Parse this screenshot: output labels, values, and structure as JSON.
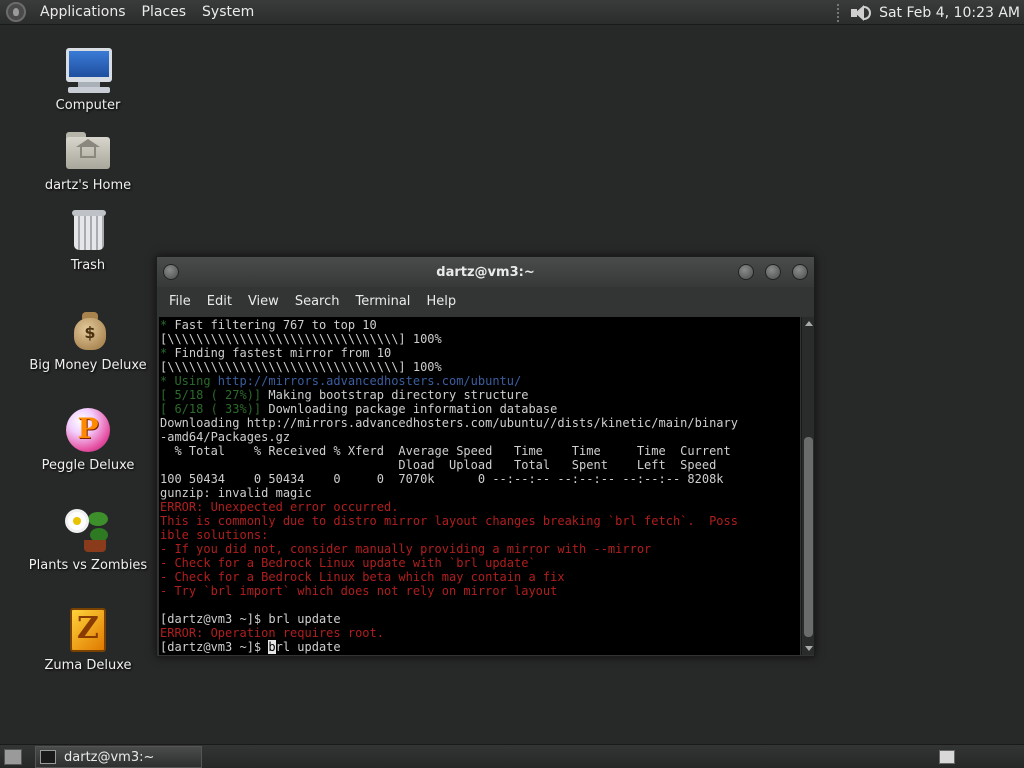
{
  "top_panel": {
    "menus": [
      "Applications",
      "Places",
      "System"
    ],
    "clock": "Sat Feb  4, 10:23 AM"
  },
  "desktop_icons": [
    {
      "name": "computer",
      "label": "Computer"
    },
    {
      "name": "home",
      "label": "dartz's Home"
    },
    {
      "name": "trash",
      "label": "Trash"
    },
    {
      "name": "money",
      "label": "Big Money Deluxe"
    },
    {
      "name": "peggle",
      "label": "Peggle Deluxe"
    },
    {
      "name": "plants",
      "label": "Plants vs Zombies"
    },
    {
      "name": "zuma",
      "label": "Zuma Deluxe"
    }
  ],
  "terminal": {
    "title": "dartz@vm3:~",
    "menus": [
      "File",
      "Edit",
      "View",
      "Search",
      "Terminal",
      "Help"
    ],
    "lines": [
      [
        {
          "t": "* ",
          "c": "g"
        },
        {
          "t": "Fast filtering 767 to top 10",
          "c": "w"
        }
      ],
      [
        {
          "t": "[\\\\\\\\\\\\\\\\\\\\\\\\\\\\\\\\\\\\\\\\\\\\\\\\\\\\\\\\\\\\\\\\] 100%",
          "c": "w"
        }
      ],
      [
        {
          "t": "* ",
          "c": "g"
        },
        {
          "t": "Finding fastest mirror from 10",
          "c": "w"
        }
      ],
      [
        {
          "t": "[\\\\\\\\\\\\\\\\\\\\\\\\\\\\\\\\\\\\\\\\\\\\\\\\\\\\\\\\\\\\\\\\] 100%",
          "c": "w"
        }
      ],
      [
        {
          "t": "* Using ",
          "c": "g"
        },
        {
          "t": "http://mirrors.advancedhosters.com/ubuntu/",
          "c": "b"
        }
      ],
      [
        {
          "t": "[ 5/18 ( 27%)] ",
          "c": "g"
        },
        {
          "t": "Making bootstrap directory structure",
          "c": "w"
        }
      ],
      [
        {
          "t": "[ 6/18 ( 33%)] ",
          "c": "g"
        },
        {
          "t": "Downloading package information database",
          "c": "w"
        }
      ],
      [
        {
          "t": "Downloading http://mirrors.advancedhosters.com/ubuntu//dists/kinetic/main/binary",
          "c": "w"
        }
      ],
      [
        {
          "t": "-amd64/Packages.gz",
          "c": "w"
        }
      ],
      [
        {
          "t": "  % Total    % Received % Xferd  Average Speed   Time    Time     Time  Current",
          "c": "w"
        }
      ],
      [
        {
          "t": "                                 Dload  Upload   Total   Spent    Left  Speed",
          "c": "w"
        }
      ],
      [
        {
          "t": "100 50434    0 50434    0     0  7070k      0 --:--:-- --:--:-- --:--:-- 8208k",
          "c": "w"
        }
      ],
      [
        {
          "t": "gunzip: invalid magic",
          "c": "w"
        }
      ],
      [
        {
          "t": "ERROR: Unexpected error occurred.",
          "c": "r"
        }
      ],
      [
        {
          "t": "This is commonly due to distro mirror layout changes breaking `brl fetch`.  Poss",
          "c": "r"
        }
      ],
      [
        {
          "t": "ible solutions:",
          "c": "r"
        }
      ],
      [
        {
          "t": "- If you did not, consider manually providing a mirror with --mirror",
          "c": "r"
        }
      ],
      [
        {
          "t": "- Check for a Bedrock Linux update with `brl update`",
          "c": "r"
        }
      ],
      [
        {
          "t": "- Check for a Bedrock Linux beta which may contain a fix",
          "c": "r"
        }
      ],
      [
        {
          "t": "- Try `brl import` which does not rely on mirror layout",
          "c": "r"
        }
      ],
      [
        {
          "t": "",
          "c": "w"
        }
      ],
      [
        {
          "t": "[dartz@vm3 ~]$ brl update",
          "c": "w"
        }
      ],
      [
        {
          "t": "ERROR: Operation requires root.",
          "c": "r"
        }
      ],
      [
        {
          "t": "[dartz@vm3 ~]$ ",
          "c": "w"
        },
        {
          "t": "b",
          "c": "cursor"
        },
        {
          "t": "rl update",
          "c": "w"
        }
      ]
    ]
  },
  "taskbar": {
    "task_label": "dartz@vm3:~"
  }
}
